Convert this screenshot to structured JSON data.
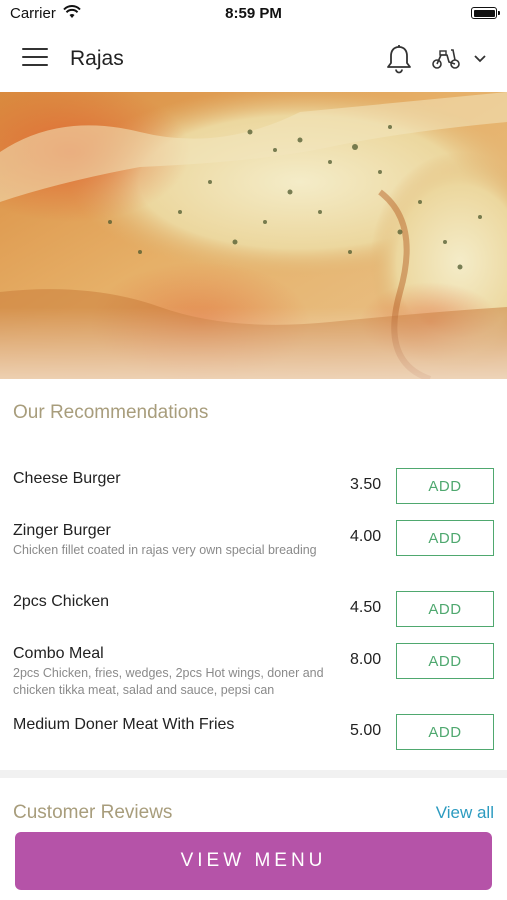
{
  "status_bar": {
    "carrier": "Carrier",
    "time": "8:59 PM"
  },
  "header": {
    "title": "Rajas",
    "icons": [
      "menu-icon",
      "bell-icon",
      "scooter-icon",
      "chevron-down-icon"
    ]
  },
  "hero": {
    "image": "pizza-photo"
  },
  "recommendations": {
    "title": "Our Recommendations",
    "items": [
      {
        "name": "Cheese Burger",
        "description": "",
        "price": "3.50",
        "button": "ADD"
      },
      {
        "name": "Zinger Burger",
        "description": "Chicken fillet coated in rajas very own special breading",
        "price": "4.00",
        "button": "ADD"
      },
      {
        "name": "2pcs Chicken",
        "description": "",
        "price": "4.50",
        "button": "ADD"
      },
      {
        "name": "Combo Meal",
        "description": "2pcs Chicken, fries, wedges, 2pcs Hot wings, doner and chicken tikka meat, salad and sauce, pepsi can",
        "price": "8.00",
        "button": "ADD"
      },
      {
        "name": "Medium Doner Meat With Fries",
        "description": "",
        "price": "5.00",
        "button": "ADD"
      }
    ]
  },
  "reviews": {
    "title": "Customer Reviews",
    "view_all": "View all"
  },
  "footer": {
    "button": "VIEW MENU"
  },
  "colors": {
    "accent": "#b553a8",
    "add_green": "#4fa86f",
    "section_title": "#a89d7c",
    "link": "#2c9bc0"
  }
}
